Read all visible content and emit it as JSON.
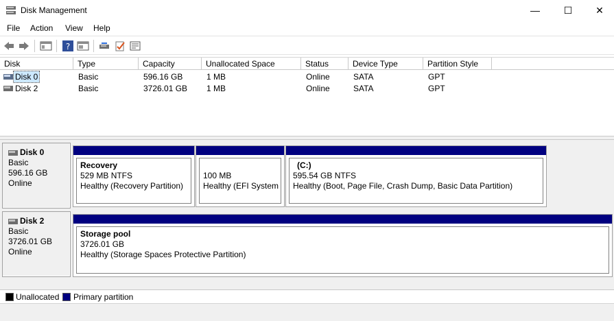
{
  "window": {
    "title": "Disk Management",
    "minimize": "—",
    "maximize": "☐",
    "close": "✕"
  },
  "menu": [
    {
      "label": "File"
    },
    {
      "label": "Action"
    },
    {
      "label": "View"
    },
    {
      "label": "Help"
    }
  ],
  "toolbar": {
    "icons": [
      "back-icon",
      "forward-icon",
      "show-hide-console-tree-icon",
      "help-icon",
      "properties-icon",
      "rescan-disks-icon",
      "refresh-icon",
      "settings-icon"
    ]
  },
  "list": {
    "columns": [
      "Disk",
      "Type",
      "Capacity",
      "Unallocated Space",
      "Status",
      "Device Type",
      "Partition Style"
    ],
    "rows": [
      {
        "disk": "Disk 0",
        "type": "Basic",
        "capacity": "596.16 GB",
        "unallocated": "1 MB",
        "status": "Online",
        "device": "SATA",
        "style": "GPT",
        "selected": true
      },
      {
        "disk": "Disk 2",
        "type": "Basic",
        "capacity": "3726.01 GB",
        "unallocated": "1 MB",
        "status": "Online",
        "device": "SATA",
        "style": "GPT",
        "selected": false
      }
    ]
  },
  "disks": [
    {
      "name": "Disk 0",
      "type": "Basic",
      "size": "596.16 GB",
      "status": "Online",
      "partitions": [
        {
          "name": "Recovery",
          "size": "529 MB NTFS",
          "health": "Healthy (Recovery Partition)"
        },
        {
          "name": "",
          "size": "100 MB",
          "health": "Healthy (EFI System Partition)"
        },
        {
          "name": "(C:)",
          "size": "595.54 GB NTFS",
          "health": "Healthy (Boot, Page File, Crash Dump, Basic Data Partition)"
        }
      ]
    },
    {
      "name": "Disk 2",
      "type": "Basic",
      "size": "3726.01 GB",
      "status": "Online",
      "partitions": [
        {
          "name": "Storage pool",
          "size": "3726.01 GB",
          "health": "Healthy (Storage Spaces Protective Partition)"
        }
      ]
    }
  ],
  "legend": [
    {
      "label": "Unallocated",
      "color": "#000000"
    },
    {
      "label": "Primary partition",
      "color": "#000080"
    }
  ]
}
